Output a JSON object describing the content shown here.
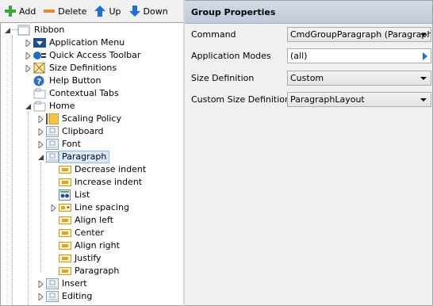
{
  "toolbar": {
    "add": "Add",
    "delete": "Delete",
    "up": "Up",
    "down": "Down"
  },
  "tree": {
    "root": "Ribbon",
    "application_menu": "Application Menu",
    "quick_access_toolbar": "Quick Access Toolbar",
    "size_definitions": "Size Definitions",
    "help_button": "Help Button",
    "contextual_tabs": "Contextual Tabs",
    "home": "Home",
    "scaling_policy": "Scaling Policy",
    "clipboard": "Clipboard",
    "font": "Font",
    "paragraph": "Paragraph",
    "decrease_indent": "Decrease indent",
    "increase_indent": "Increase indent",
    "list": "List",
    "line_spacing": "Line spacing",
    "align_left": "Align left",
    "center": "Center",
    "align_right": "Align right",
    "justify": "Justify",
    "paragraph_item": "Paragraph",
    "insert": "Insert",
    "editing": "Editing"
  },
  "properties": {
    "header": "Group Properties",
    "command_label": "Command",
    "command_value": "CmdGroupParagraph (Paragraph)",
    "app_modes_label": "Application Modes",
    "app_modes_value": "(all)",
    "size_def_label": "Size Definition",
    "size_def_value": "Custom",
    "custom_size_label": "Custom Size Definition",
    "custom_size_value": "ParagraphLayout"
  },
  "colors": {
    "selection_bg": "#d9e8fb",
    "selection_border": "#8fb8ea",
    "header_bg": "#c9d3de",
    "add_green": "#3aa935",
    "delete_orange": "#f08a24",
    "arrow_blue": "#1a6fd8"
  }
}
